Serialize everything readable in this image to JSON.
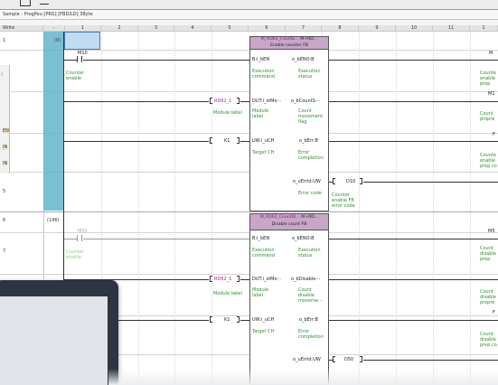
{
  "window": {
    "title": "Sample : ProgPou [PRG] [FBD/LD] 38yte"
  },
  "header": {
    "mode": "Write",
    "dash": "-",
    "columns": [
      "1",
      "2",
      "3",
      "4",
      "5",
      "6",
      "7",
      "8",
      "9",
      "10",
      "11",
      "1"
    ]
  },
  "rows": [
    "1",
    "2",
    "3",
    "4",
    "5",
    "6",
    "7"
  ],
  "steps": {
    "first": "(0)",
    "second": "(146)"
  },
  "side_labels": {
    "en": "EN",
    "in1": "IN",
    "in2": "IN"
  },
  "rung1": {
    "contact": "M10",
    "contact_label": [
      "Counter",
      "enable"
    ],
    "fb_type": "M_RD62_CountE...",
    "fb_name": "M+RD...",
    "fb_desc": "Enable counter FB",
    "in_en": "B:i_bEN",
    "in_en_desc": [
      "Execution",
      "command"
    ],
    "out_eno": "o_bENO:B",
    "out_eno_desc": [
      "Execution",
      "status"
    ],
    "in_dut": "DUT:i_stMo···",
    "in_dut_var": "RD62_1",
    "in_dut_desc": "Module label",
    "in_dut_pin_desc": [
      "Module",
      "label"
    ],
    "out_count": "o_bCountS···",
    "out_count_desc": [
      "Count",
      "movement",
      "flag"
    ],
    "in_ch": "UW:i_uCH",
    "in_ch_var": "K1",
    "in_ch_desc": "Target CH",
    "out_err": "o_bErr:B",
    "out_err_desc": [
      "Error",
      "completion"
    ],
    "out_errid": "o_uErrId:UW",
    "out_errid_desc": "Error code",
    "out_errid_var": "D10",
    "out_errid_note": [
      "Counter",
      "enable FB",
      "error code"
    ],
    "right_labels": [
      [
        "Counte",
        "enable",
        "prep"
      ],
      [
        "M1"
      ],
      [
        "Count",
        "propre"
      ],
      [
        "F"
      ],
      [
        "Counte",
        "enable",
        "prep co"
      ]
    ]
  },
  "rung2": {
    "contact": "M50",
    "contact_label": [
      "Counter",
      "enable"
    ],
    "fb_type": "M_RD62_CountDi...",
    "fb_name": "M+RD...",
    "fb_desc": "Disable count FB",
    "in_en": "B:i_bEN",
    "in_en_desc": [
      "Execution",
      "command"
    ],
    "out_eno": "o_bENO:B",
    "out_eno_desc": [
      "Execution",
      "status"
    ],
    "in_dut": "DUT:i_stMo···",
    "in_dut_var": "RD62_1",
    "in_dut_desc": "Module label",
    "in_dut_pin_desc": [
      "Module",
      "label"
    ],
    "out_disable": "o_bDisable···",
    "out_disable_desc": [
      "Count",
      "disable",
      "moveme···"
    ],
    "in_ch": "UW:i_uCH",
    "in_ch_var": "K1",
    "in_ch_desc": "Target CH",
    "out_err": "o_bErr:B",
    "out_err_desc": [
      "Error",
      "completion"
    ],
    "out_errid": "o_uErrId:UW",
    "out_errid_var": "D50",
    "right_labels": [
      [
        "Count",
        "disable",
        "prep"
      ],
      [
        "M5"
      ],
      [
        "Count",
        "disable",
        "propre"
      ],
      [
        "F"
      ],
      [
        "Count",
        "disable",
        "prep co"
      ]
    ]
  },
  "colors": {
    "fb_header": "#c7a6c7",
    "selection": "#5bb3c8",
    "comment_green": "#2f8f2f",
    "var_magenta": "#b02090"
  }
}
